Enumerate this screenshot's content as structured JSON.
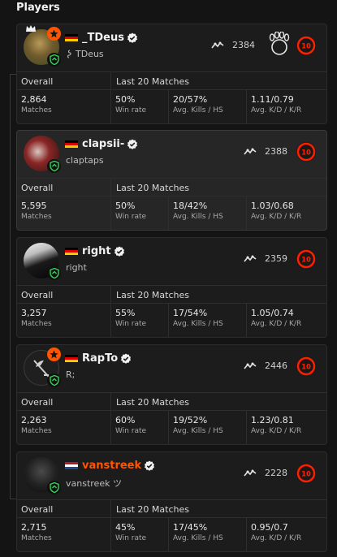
{
  "heading": "Players",
  "headers": {
    "overall": "Overall",
    "last": "Last 20 Matches"
  },
  "labels": {
    "matches": "Matches",
    "win_rate": "Win rate",
    "kills_hs": "Avg. Kills / HS",
    "kd_kr": "Avg. K/D / K/R"
  },
  "colors": {
    "accent": "#ff5500",
    "shield": "#32d35a"
  },
  "players": [
    {
      "name": "_TDeus",
      "handle": "TDeus",
      "elo": "2384",
      "level": "10",
      "matches": "2,864",
      "win_rate": "50%",
      "kills_hs": "20/57%",
      "kd_kr": "1.11/0.79",
      "flag": "de",
      "name_color": "#f2f2f2"
    },
    {
      "name": "clapsii-",
      "handle": "claptaps",
      "elo": "2388",
      "level": "10",
      "matches": "5,595",
      "win_rate": "50%",
      "kills_hs": "18/42%",
      "kd_kr": "1.03/0.68",
      "flag": "de",
      "name_color": "#f2f2f2"
    },
    {
      "name": "right",
      "handle": "right",
      "elo": "2359",
      "level": "10",
      "matches": "3,257",
      "win_rate": "55%",
      "kills_hs": "17/54%",
      "kd_kr": "1.05/0.74",
      "flag": "de",
      "name_color": "#f2f2f2"
    },
    {
      "name": "RapTo",
      "handle": "R;",
      "elo": "2446",
      "level": "10",
      "matches": "2,263",
      "win_rate": "60%",
      "kills_hs": "19/52%",
      "kd_kr": "1.23/0.81",
      "flag": "de",
      "name_color": "#f2f2f2"
    },
    {
      "name": "vanstreek",
      "handle": "vanstreek ツ",
      "elo": "2228",
      "level": "10",
      "matches": "2,715",
      "win_rate": "45%",
      "kills_hs": "17/45%",
      "kd_kr": "0.95/0.7",
      "flag": "nl",
      "name_color": "#ff5500"
    }
  ]
}
